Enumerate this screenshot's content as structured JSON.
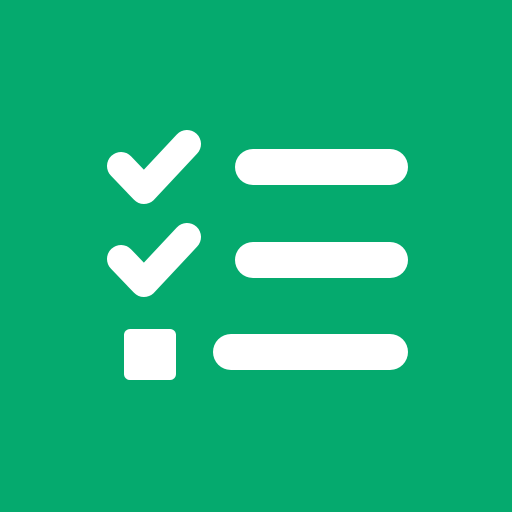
{
  "icon": {
    "name": "checklist-icon",
    "background_color": "#05AA6E",
    "foreground_color": "#FFFFFF",
    "items": [
      {
        "state": "checked",
        "marker_icon": "checkmark-icon"
      },
      {
        "state": "checked",
        "marker_icon": "checkmark-icon"
      },
      {
        "state": "unchecked",
        "marker_icon": "empty-square-icon"
      }
    ]
  }
}
